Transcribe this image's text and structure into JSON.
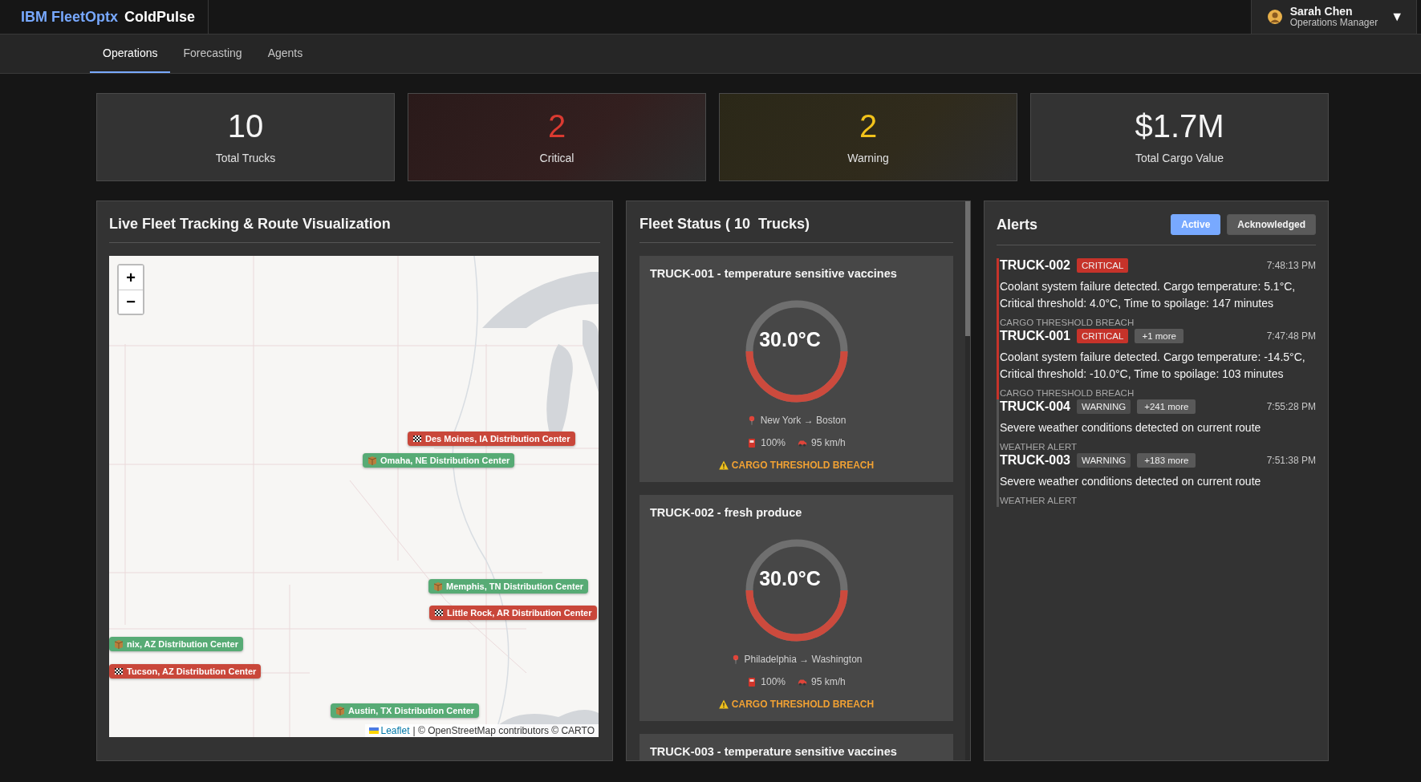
{
  "header": {
    "brand": "IBM FleetOptx",
    "product": "ColdPulse",
    "user": {
      "name": "Sarah Chen",
      "role": "Operations Manager",
      "menu_icon": "▼"
    }
  },
  "tabs": [
    {
      "label": "Operations",
      "selected": true
    },
    {
      "label": "Forecasting",
      "selected": false
    },
    {
      "label": "Agents",
      "selected": false
    }
  ],
  "kpis": [
    {
      "value": "10",
      "label": "Total Trucks",
      "kind": "neutral"
    },
    {
      "value": "2",
      "label": "Critical",
      "kind": "critical"
    },
    {
      "value": "2",
      "label": "Warning",
      "kind": "warning"
    },
    {
      "value": "$1.7M",
      "label": "Total Cargo Value",
      "kind": "neutral"
    }
  ],
  "map": {
    "title": "Live Fleet Tracking & Route Visualization",
    "zoom_in": "+",
    "zoom_out": "−",
    "markers": [
      {
        "label": "Des Moines, IA Distribution Center",
        "kind": "destination"
      },
      {
        "label": "Omaha, NE Distribution Center",
        "kind": "origin"
      },
      {
        "label": "Memphis, TN Distribution Center",
        "kind": "origin"
      },
      {
        "label": "Little Rock, AR Distribution Center",
        "kind": "destination"
      },
      {
        "label": "nix, AZ Distribution Center",
        "kind": "origin"
      },
      {
        "label": "Tucson, AZ Distribution Center",
        "kind": "destination"
      },
      {
        "label": "Austin, TX Distribution Center",
        "kind": "origin"
      }
    ],
    "attribution": {
      "link": "Leaflet",
      "text": "| © OpenStreetMap contributors © CARTO"
    }
  },
  "fleet": {
    "title": "Fleet Status ( 10  Trucks)",
    "trucks": [
      {
        "title": "TRUCK-001 - temperature sensitive vaccines",
        "temperature": "30.0°C",
        "route": "New York → Boston",
        "fuel": "100%",
        "speed": "95 km/h",
        "alert": "CARGO THRESHOLD BREACH"
      },
      {
        "title": "TRUCK-002 - fresh produce",
        "temperature": "30.0°C",
        "route": "Philadelphia → Washington",
        "fuel": "100%",
        "speed": "95 km/h",
        "alert": "CARGO THRESHOLD BREACH"
      },
      {
        "title": "TRUCK-003 - temperature sensitive vaccines"
      }
    ]
  },
  "alerts": {
    "title": "Alerts",
    "filters": [
      {
        "label": "Active",
        "selected": true
      },
      {
        "label": "Acknowledged",
        "selected": false
      }
    ],
    "items": [
      {
        "truck": "TRUCK-002",
        "severity": "CRITICAL",
        "kind": "critical",
        "time": "7:48:13 PM",
        "message": "Coolant system failure detected. Cargo temperature: 5.1°C, Critical threshold: 4.0°C, Time to spoilage: 147 minutes",
        "type": "CARGO THRESHOLD BREACH"
      },
      {
        "truck": "TRUCK-001",
        "severity": "CRITICAL",
        "kind": "critical",
        "more": "+1 more",
        "time": "7:47:48 PM",
        "message": "Coolant system failure detected. Cargo temperature: -14.5°C, Critical threshold: -10.0°C, Time to spoilage: 103 minutes",
        "type": "CARGO THRESHOLD BREACH"
      },
      {
        "truck": "TRUCK-004",
        "severity": "WARNING",
        "kind": "warning",
        "more": "+241 more",
        "time": "7:55:28 PM",
        "message": "Severe weather conditions detected on current route",
        "type": "WEATHER ALERT"
      },
      {
        "truck": "TRUCK-003",
        "severity": "WARNING",
        "kind": "warning",
        "more": "+183 more",
        "time": "7:51:38 PM",
        "message": "Severe weather conditions detected on current route",
        "type": "WEATHER ALERT"
      }
    ]
  }
}
